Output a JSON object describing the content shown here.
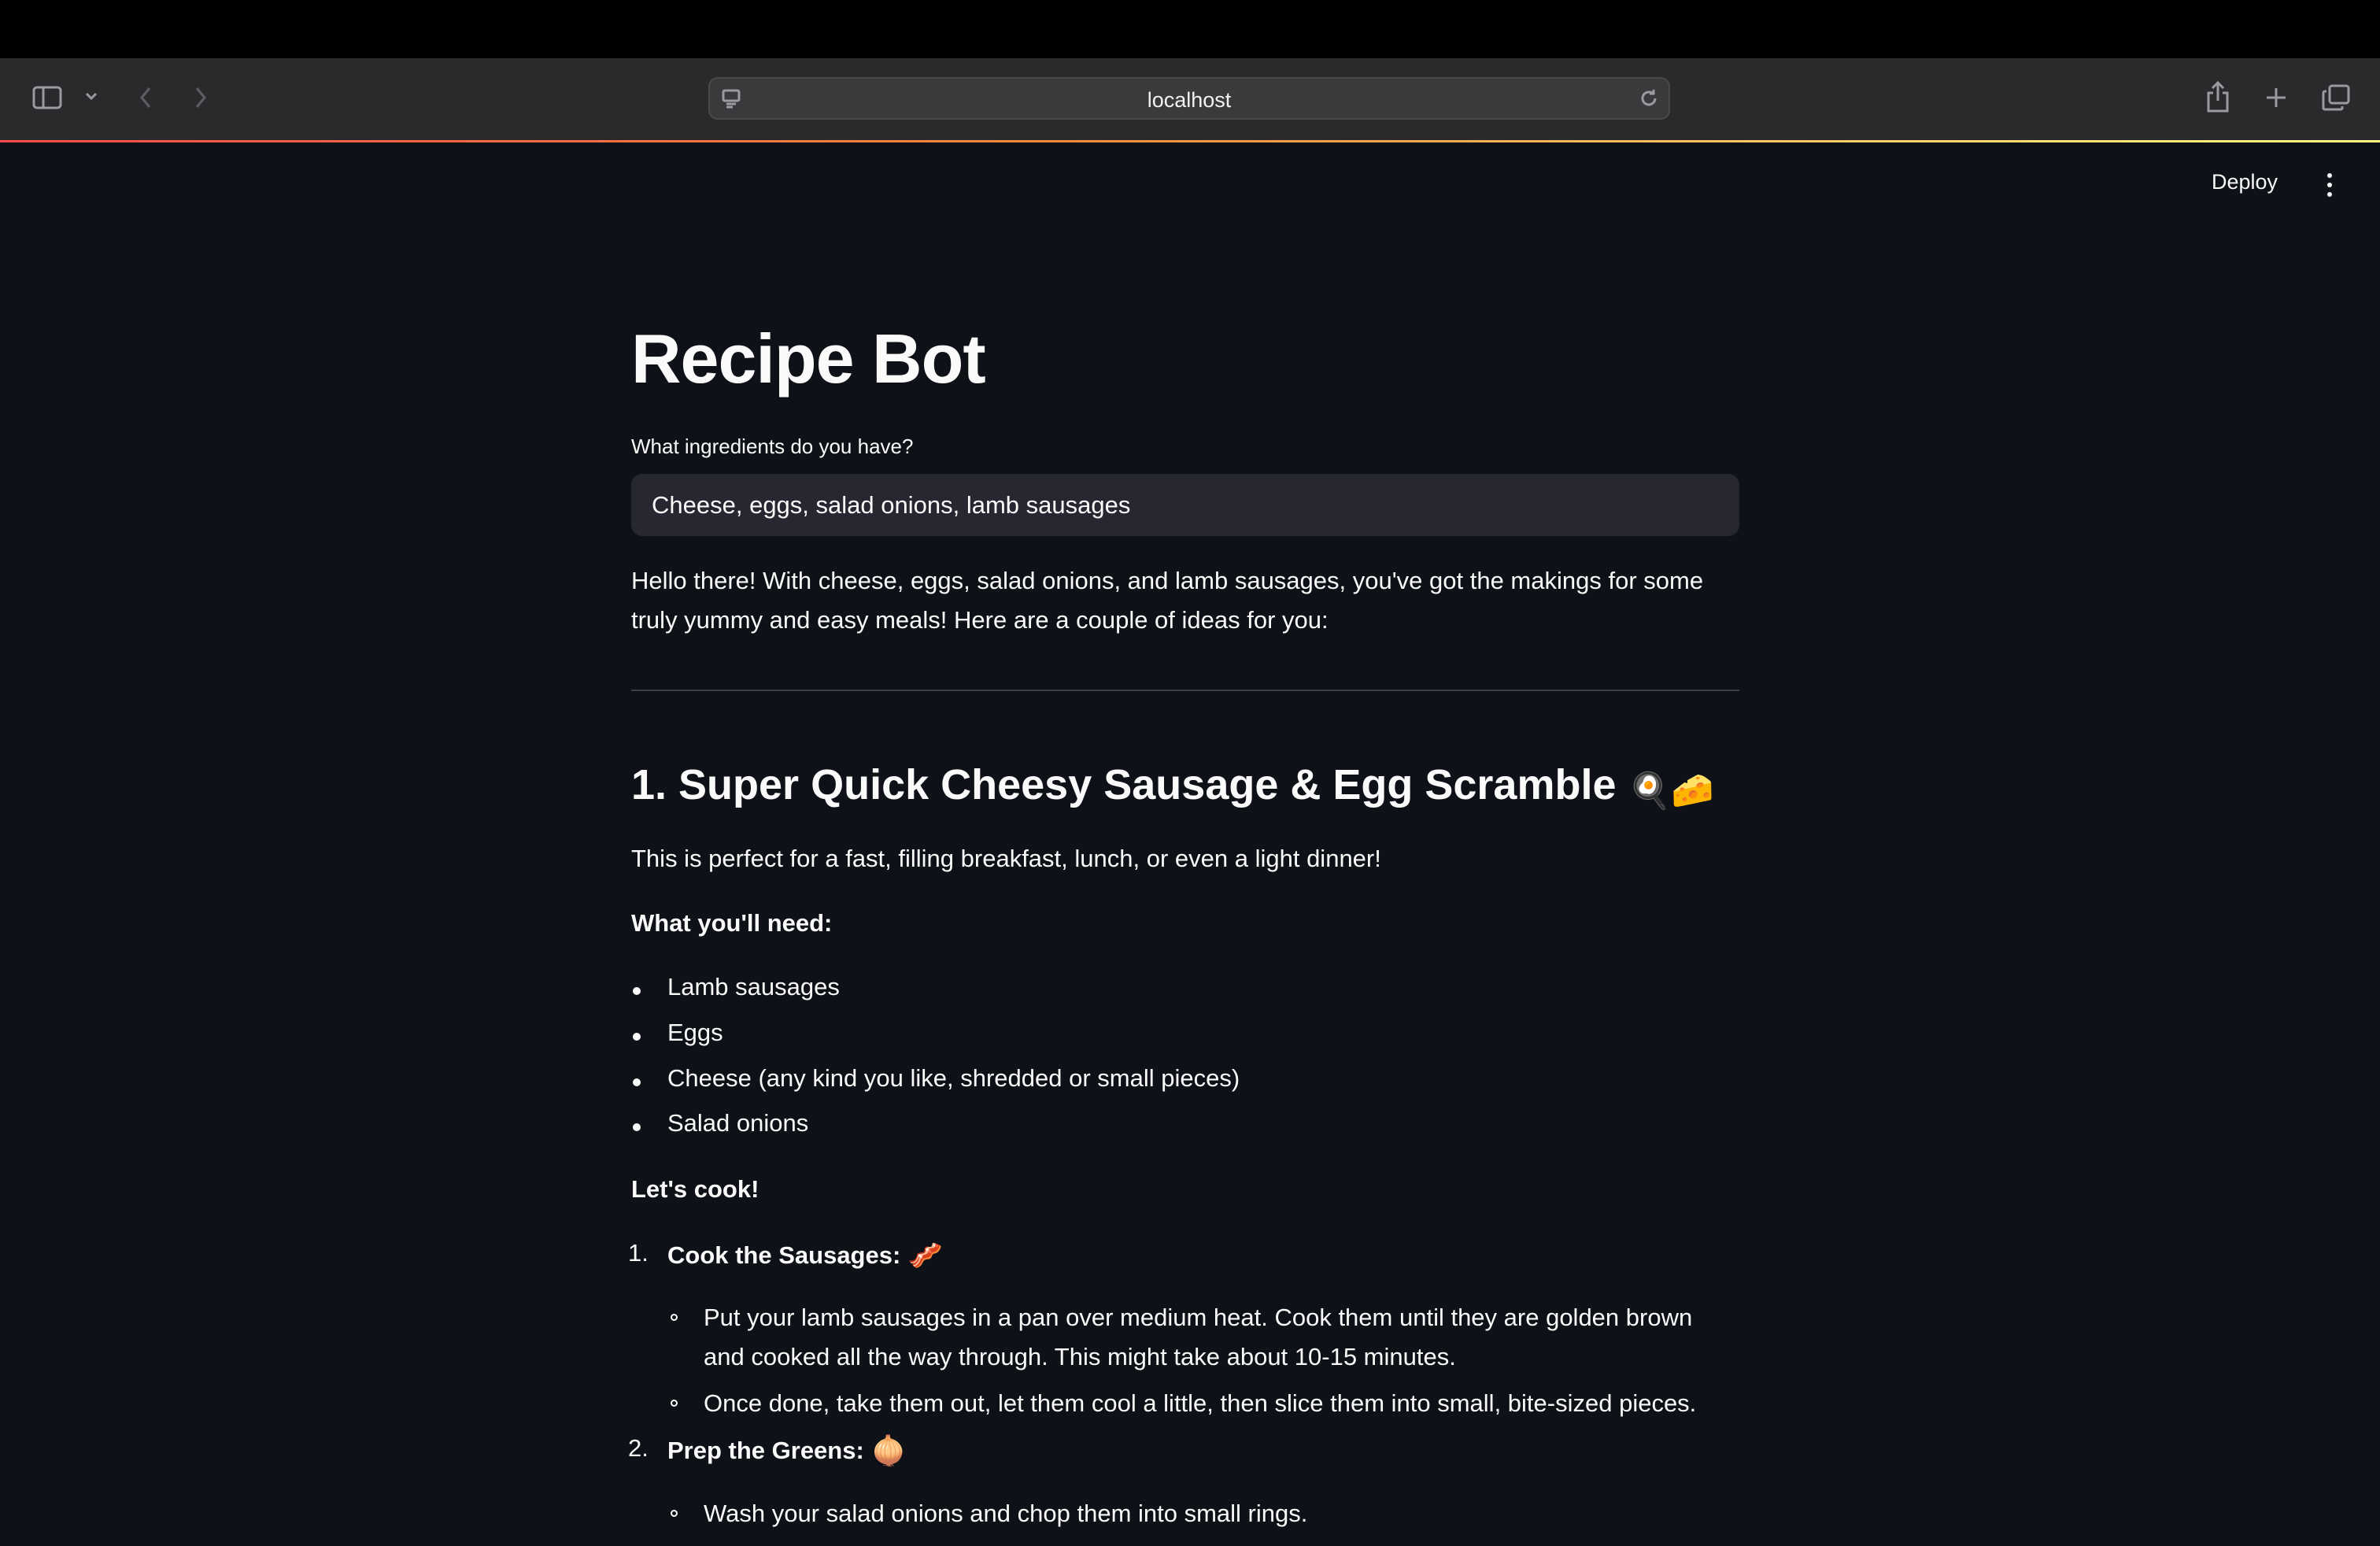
{
  "browser": {
    "url": "localhost"
  },
  "app_header": {
    "deploy_label": "Deploy"
  },
  "page": {
    "title": "Recipe Bot",
    "input_label": "What ingredients do you have?",
    "input_value": "Cheese, eggs, salad onions, lamb sausages",
    "intro": "Hello there! With cheese, eggs, salad onions, and lamb sausages, you've got the makings for some truly yummy and easy meals! Here are a couple of ideas for you:",
    "recipe1": {
      "heading": "1. Super Quick Cheesy Sausage & Egg Scramble",
      "heading_emojis": "🍳🧀",
      "description": "This is perfect for a fast, filling breakfast, lunch, or even a light dinner!",
      "need_label": "What you'll need:",
      "ingredients": [
        "Lamb sausages",
        "Eggs",
        "Cheese (any kind you like, shredded or small pieces)",
        "Salad onions"
      ],
      "cook_label": "Let's cook!",
      "steps": [
        {
          "number": "1.",
          "title": "Cook the Sausages:",
          "emoji": "🥓",
          "substeps": [
            "Put your lamb sausages in a pan over medium heat. Cook them until they are golden brown and cooked all the way through. This might take about 10-15 minutes.",
            "Once done, take them out, let them cool a little, then slice them into small, bite-sized pieces."
          ]
        },
        {
          "number": "2.",
          "title": "Prep the Greens:",
          "emoji": "🧅",
          "substeps": [
            "Wash your salad onions and chop them into small rings."
          ]
        }
      ]
    }
  }
}
